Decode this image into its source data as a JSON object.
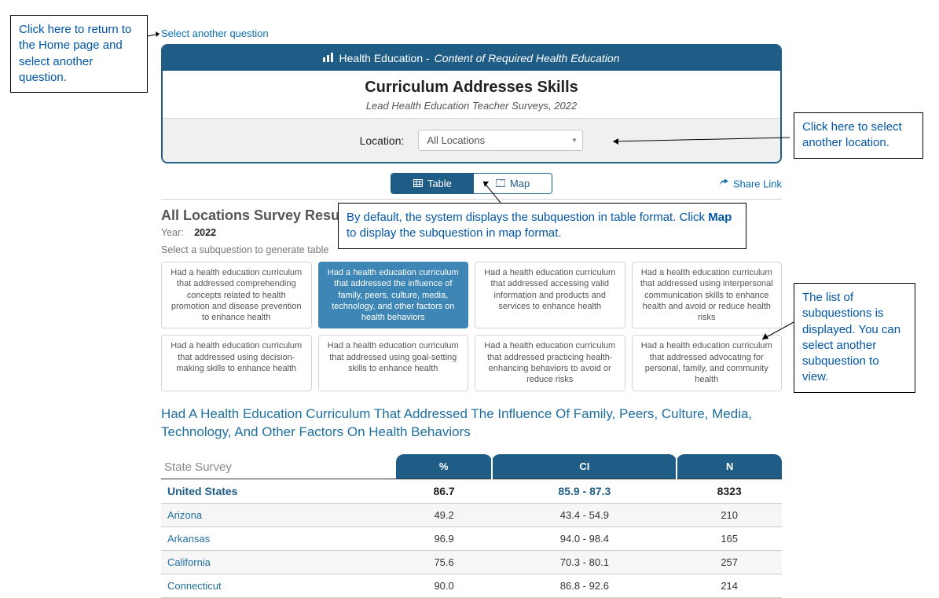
{
  "annotations": {
    "return_home": "Click here to return to the Home page and select another question.",
    "select_location": "Click here to select another location.",
    "view_mode_1": "By default, the system displays the subquestion in table format. Click ",
    "view_mode_bold": "Map",
    "view_mode_2": " to display the subquestion in map format.",
    "subq_list": "The list of subquestions is displayed. You can select another subquestion to view."
  },
  "nav": {
    "select_another_question": "Select another question"
  },
  "panel": {
    "breadcrumb_major": "Health Education -",
    "breadcrumb_minor": "Content of Required Health Education",
    "title": "Curriculum Addresses Skills",
    "subtitle": "Lead Health Education Teacher Surveys, 2022",
    "location_label": "Location:",
    "location_value": "All Locations"
  },
  "tabs": {
    "table": "Table",
    "map": "Map"
  },
  "share_link_label": "Share Link",
  "results": {
    "heading": "All Locations Survey Results",
    "year_label": "Year:",
    "year_value": "2022",
    "subq_prompt": "Select a subquestion to generate table"
  },
  "subquestions": [
    "Had a health education curriculum that addressed comprehending concepts related to health promotion and disease prevention to enhance health",
    "Had a health education curriculum that addressed the influence of family, peers, culture, media, technology, and other factors on health behaviors",
    "Had a health education curriculum that addressed accessing valid information and products and services to enhance health",
    "Had a health education curriculum that addressed using interpersonal communication skills to enhance health and avoid or reduce health risks",
    "Had a health education curriculum that addressed using decision-making skills to enhance health",
    "Had a health education curriculum that addressed using goal-setting skills to enhance health",
    "Had a health education curriculum that addressed practicing health-enhancing behaviors to avoid or reduce risks",
    "Had a health education curriculum that addressed advocating for personal, family, and community health"
  ],
  "active_subquestion_index": 1,
  "long_title": "Had A Health Education Curriculum That Addressed The Influence Of Family, Peers, Culture, Media, Technology, And Other Factors On Health Behaviors",
  "table": {
    "state_header": "State Survey",
    "columns": [
      "%",
      "CI",
      "N"
    ]
  },
  "chart_data": {
    "type": "table",
    "title": "Had A Health Education Curriculum That Addressed The Influence Of Family, Peers, Culture, Media, Technology, And Other Factors On Health Behaviors",
    "columns": [
      "State Survey",
      "%",
      "CI",
      "N"
    ],
    "rows": [
      {
        "state": "United States",
        "pct": 86.7,
        "ci": "85.9 - 87.3",
        "n": 8323,
        "is_total": true
      },
      {
        "state": "Arizona",
        "pct": 49.2,
        "ci": "43.4 - 54.9",
        "n": 210
      },
      {
        "state": "Arkansas",
        "pct": 96.9,
        "ci": "94.0 - 98.4",
        "n": 165
      },
      {
        "state": "California",
        "pct": 75.6,
        "ci": "70.3 - 80.1",
        "n": 257
      },
      {
        "state": "Connecticut",
        "pct": 90.0,
        "ci": "86.8 - 92.6",
        "n": 214
      }
    ]
  }
}
